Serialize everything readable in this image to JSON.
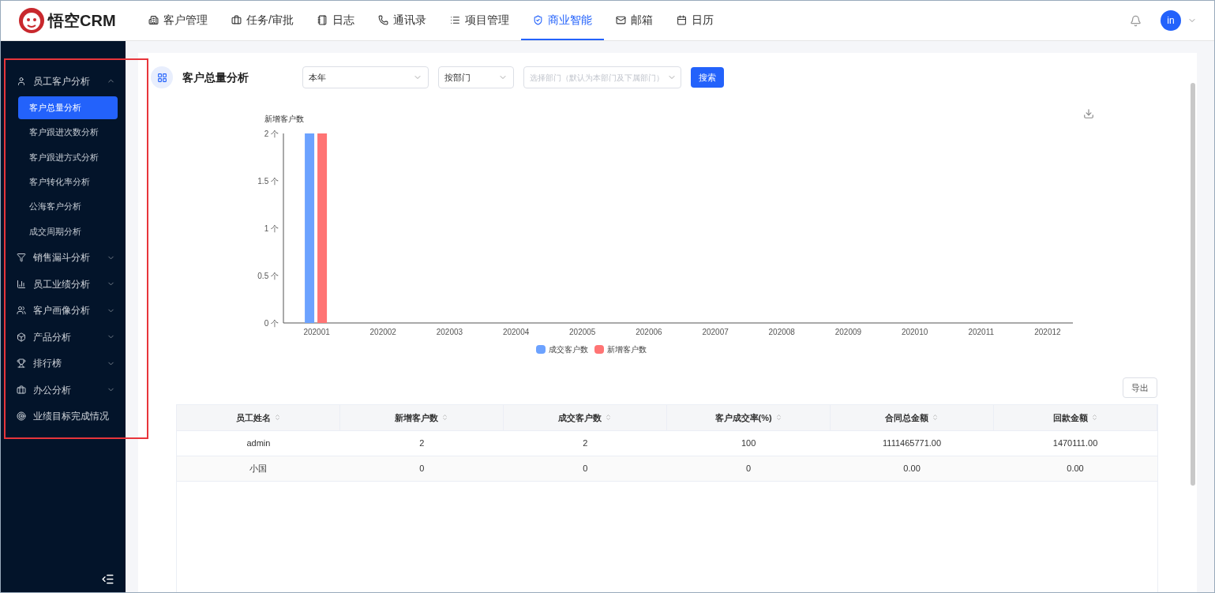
{
  "logo": {
    "text": "悟空CRM"
  },
  "nav": [
    {
      "label": "客户管理",
      "selected": false
    },
    {
      "label": "任务/审批",
      "selected": false
    },
    {
      "label": "日志",
      "selected": false
    },
    {
      "label": "通讯录",
      "selected": false
    },
    {
      "label": "项目管理",
      "selected": false
    },
    {
      "label": "商业智能",
      "selected": true
    },
    {
      "label": "邮箱",
      "selected": false
    },
    {
      "label": "日历",
      "selected": false
    }
  ],
  "user": {
    "avatar": "in"
  },
  "sidebar": {
    "items": [
      {
        "label": "员工客户分析",
        "expanded": true,
        "children": [
          {
            "label": "客户总量分析",
            "selected": true
          },
          {
            "label": "客户跟进次数分析",
            "selected": false
          },
          {
            "label": "客户跟进方式分析",
            "selected": false
          },
          {
            "label": "客户转化率分析",
            "selected": false
          },
          {
            "label": "公海客户分析",
            "selected": false
          },
          {
            "label": "成交周期分析",
            "selected": false
          }
        ]
      },
      {
        "label": "销售漏斗分析",
        "expanded": false
      },
      {
        "label": "员工业绩分析",
        "expanded": false
      },
      {
        "label": "客户画像分析",
        "expanded": false
      },
      {
        "label": "产品分析",
        "expanded": false
      },
      {
        "label": "排行榜",
        "expanded": false
      },
      {
        "label": "办公分析",
        "expanded": false
      },
      {
        "label": "业绩目标完成情况"
      }
    ]
  },
  "header": {
    "title": "客户总量分析",
    "filters": [
      {
        "value": "本年"
      },
      {
        "value": "按部门"
      },
      {
        "placeholder": "选择部门（默认为本部门及下属部门）"
      }
    ],
    "search_button": "搜索"
  },
  "chart": {
    "chart_data": {
      "type": "bar",
      "legend": "bottom",
      "ylabel": "新增客户数",
      "categories": [
        "202001",
        "202002",
        "202003",
        "202004",
        "202005",
        "202006",
        "202007",
        "202008",
        "202009",
        "202010",
        "202011",
        "202012"
      ],
      "series": [
        {
          "name": "成交客户数",
          "color": "#6ca2ff",
          "values": [
            2,
            0,
            0,
            0,
            0,
            0,
            0,
            0,
            0,
            0,
            0,
            0
          ]
        },
        {
          "name": "新增客户数",
          "color": "#ff7474",
          "values": [
            2,
            0,
            0,
            0,
            0,
            0,
            0,
            0,
            0,
            0,
            0,
            0
          ]
        }
      ],
      "ylim": [
        0,
        2
      ],
      "yticks": [
        {
          "value": 0,
          "label": "0 个"
        },
        {
          "value": 0.5,
          "label": "0.5 个"
        },
        {
          "value": 1,
          "label": "1 个"
        },
        {
          "value": 1.5,
          "label": "1.5 个"
        },
        {
          "value": 2,
          "label": "2 个"
        }
      ]
    }
  },
  "export_button": "导出",
  "table": {
    "columns": [
      "员工姓名",
      "新增客户数",
      "成交客户数",
      "客户成交率(%)",
      "合同总金额",
      "回款金额"
    ],
    "rows": [
      [
        "admin",
        "2",
        "2",
        "100",
        "1111465771.00",
        "1470111.00"
      ],
      [
        "小国",
        "0",
        "0",
        "0",
        "0.00",
        "0.00"
      ]
    ]
  }
}
